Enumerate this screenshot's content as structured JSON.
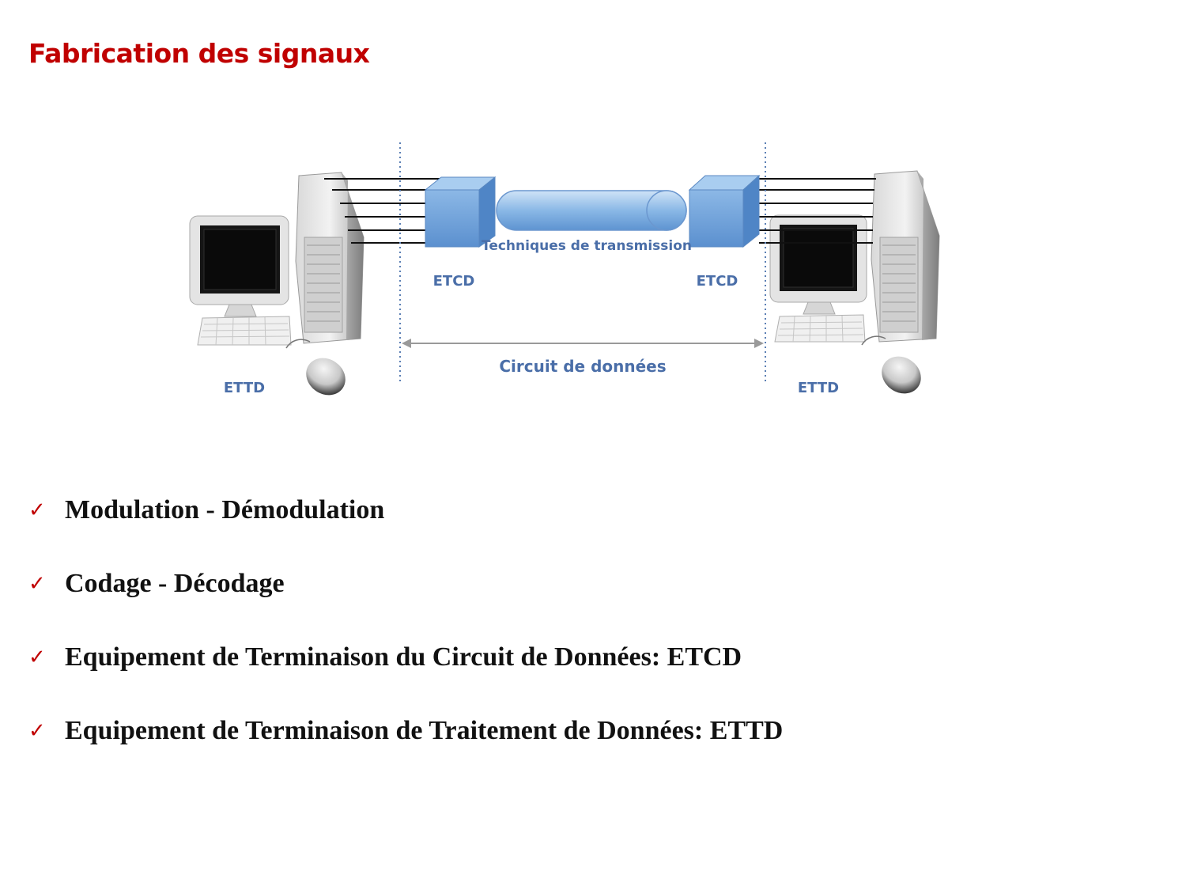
{
  "title": "Fabrication des signaux",
  "diagram": {
    "left_terminal": "ETTD",
    "right_terminal": "ETTD",
    "left_modem": "ETCD",
    "right_modem": "ETCD",
    "channel": "Techniques de transmission",
    "circuit": "Circuit de données"
  },
  "bullets": [
    "Modulation - Démodulation",
    "Codage - Décodage",
    "Equipement de Terminaison du Circuit de Données: ETCD",
    "Equipement de Terminaison de Traitement de Données: ETTD"
  ],
  "colors": {
    "title": "#c00000",
    "label": "#4a6ea8",
    "modem": "#6a9fd8",
    "check": "#c00000"
  },
  "icons": [
    "computer-tower-icon",
    "monitor-icon",
    "keyboard-icon",
    "mouse-icon",
    "check-icon"
  ]
}
